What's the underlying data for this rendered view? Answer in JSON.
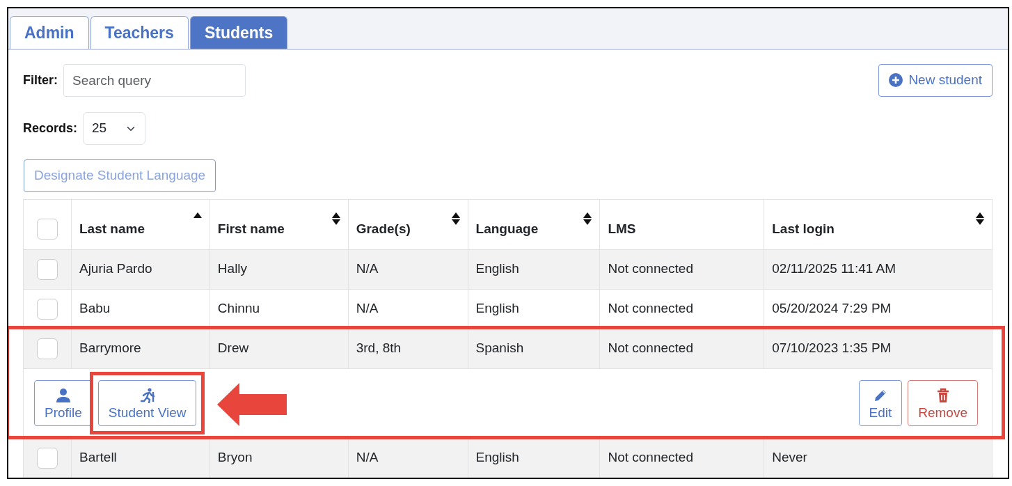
{
  "tabs": [
    {
      "label": "Admin",
      "selected": false
    },
    {
      "label": "Teachers",
      "selected": false
    },
    {
      "label": "Students",
      "selected": true
    }
  ],
  "filter": {
    "label": "Filter:",
    "placeholder": "Search query"
  },
  "new_button": {
    "label": "New student"
  },
  "records": {
    "label": "Records:",
    "value": "25"
  },
  "designate_button": {
    "label": "Designate Student Language",
    "disabled": true
  },
  "table": {
    "select_all_checked": false,
    "columns": [
      {
        "label": "Last name",
        "kind": "ascending"
      },
      {
        "label": "First name",
        "kind": "sortable"
      },
      {
        "label": "Grade(s)",
        "kind": "sortable"
      },
      {
        "label": "Language",
        "kind": "sortable"
      },
      {
        "label": "LMS",
        "kind": "plain"
      },
      {
        "label": "Last login",
        "kind": "sortable"
      }
    ],
    "rows": [
      {
        "checked": false,
        "highlighted": false,
        "cells": [
          "Ajuria Pardo",
          "Hally",
          "N/A",
          "English",
          "Not connected",
          "02/11/2025 11:41 AM"
        ]
      },
      {
        "checked": false,
        "highlighted": false,
        "cells": [
          "Babu",
          "Chinnu",
          "N/A",
          "English",
          "Not connected",
          "05/20/2024 7:29 PM"
        ]
      },
      {
        "checked": false,
        "highlighted": true,
        "cells": [
          "Barrymore",
          "Drew",
          "3rd, 8th",
          "Spanish",
          "Not connected",
          "07/10/2023 1:35 PM"
        ],
        "actions": [
          {
            "kind": "profile",
            "label": "Profile",
            "highlighted": false
          },
          {
            "kind": "student_view",
            "label": "Student View",
            "highlighted": true
          },
          {
            "kind": "edit",
            "label": "Edit",
            "highlighted": false
          },
          {
            "kind": "remove",
            "label": "Remove",
            "highlighted": false
          }
        ]
      },
      {
        "checked": false,
        "highlighted": false,
        "cells": [
          "Bartell",
          "Bryon",
          "N/A",
          "English",
          "Not connected",
          "Never"
        ]
      }
    ]
  }
}
